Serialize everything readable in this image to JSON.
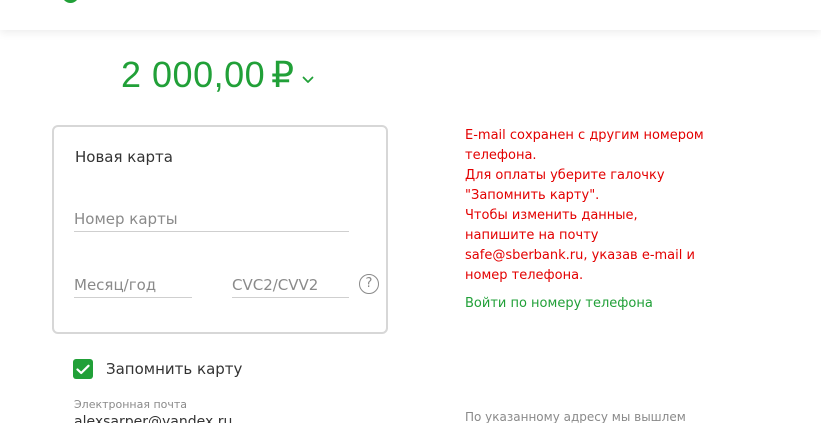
{
  "payment": {
    "amount": "2 000,00",
    "currency": "₽"
  },
  "card_form": {
    "title": "Новая карта",
    "card_number_placeholder": "Номер карты",
    "expiry_placeholder": "Месяц/год",
    "cvc_placeholder": "CVC2/CVV2",
    "help_glyph": "?"
  },
  "remember_card": {
    "label": "Запомнить карту",
    "checked": true
  },
  "email": {
    "label": "Электронная почта",
    "value": "alexsarper@yandex.ru"
  },
  "error_message": {
    "lines": [
      "E-mail сохранен с другим номером",
      "телефона.",
      "Для оплаты уберите галочку",
      "\"Запомнить карту\".",
      "Чтобы изменить данные,",
      "напишите на почту",
      "safe@sberbank.ru, указав e-mail и",
      "номер телефона."
    ]
  },
  "phone_login_link": "Войти по номеру телефона",
  "bottom_note": "По указанному адресу мы вышлем",
  "colors": {
    "accent_green": "#21a038",
    "error_red": "#e30000",
    "border_gray": "#d7d7d7"
  },
  "icons": {
    "chevron": "chevron-down-icon",
    "checkmark": "check-icon",
    "help": "help-circle-icon"
  }
}
